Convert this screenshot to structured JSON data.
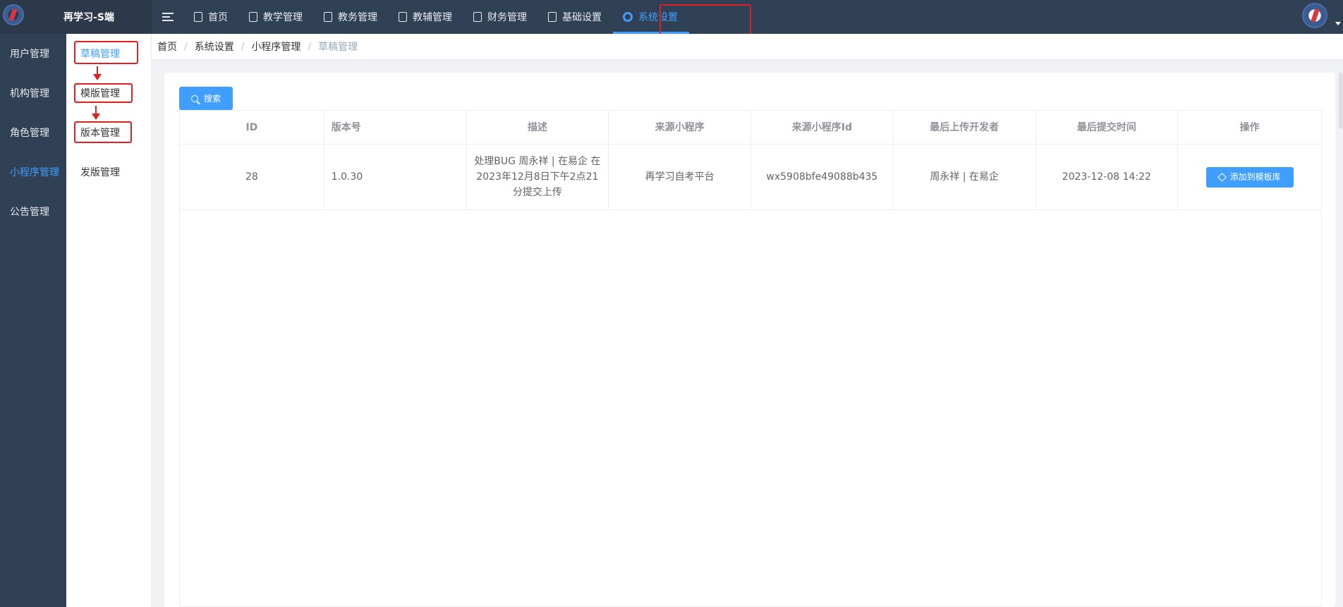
{
  "brand": {
    "title": "再学习-S端"
  },
  "topnav": [
    {
      "label": "首页",
      "icon": "home-icon"
    },
    {
      "label": "教学管理",
      "icon": "book-icon"
    },
    {
      "label": "教务管理",
      "icon": "document-icon"
    },
    {
      "label": "教辅管理",
      "icon": "notebook-icon"
    },
    {
      "label": "财务管理",
      "icon": "tag-icon"
    },
    {
      "label": "基础设置",
      "icon": "file-icon"
    },
    {
      "label": "系统设置",
      "icon": "gear-icon",
      "active": true
    }
  ],
  "sidebar": {
    "items": [
      {
        "label": "用户管理"
      },
      {
        "label": "机构管理"
      },
      {
        "label": "角色管理"
      },
      {
        "label": "小程序管理",
        "active": true
      },
      {
        "label": "公告管理"
      }
    ]
  },
  "subsidebar": {
    "items": [
      {
        "label": "草稿管理",
        "active": true
      },
      {
        "label": "模版管理"
      },
      {
        "label": "版本管理"
      },
      {
        "label": "发版管理"
      }
    ]
  },
  "breadcrumb": [
    "首页",
    "系统设置",
    "小程序管理",
    "草稿管理"
  ],
  "toolbar": {
    "search_label": "搜索"
  },
  "table": {
    "headers": [
      "ID",
      "版本号",
      "描述",
      "来源小程序",
      "来源小程序Id",
      "最后上传开发者",
      "最后提交时间",
      "操作"
    ],
    "rows": [
      {
        "id": "28",
        "version": "1.0.30",
        "description": "处理BUG 周永祥 | 在易企 在2023年12月8日下午2点21分提交上传",
        "source_app": "再学习自考平台",
        "source_app_id": "wx5908bfe49088b435",
        "developer": "周永祥 | 在易企",
        "submit_time": "2023-12-08 14:22",
        "action_label": "添加到模板库"
      }
    ]
  },
  "colors": {
    "accent": "#409eff",
    "nav_bg": "#304156",
    "highlight": "#e02020"
  }
}
